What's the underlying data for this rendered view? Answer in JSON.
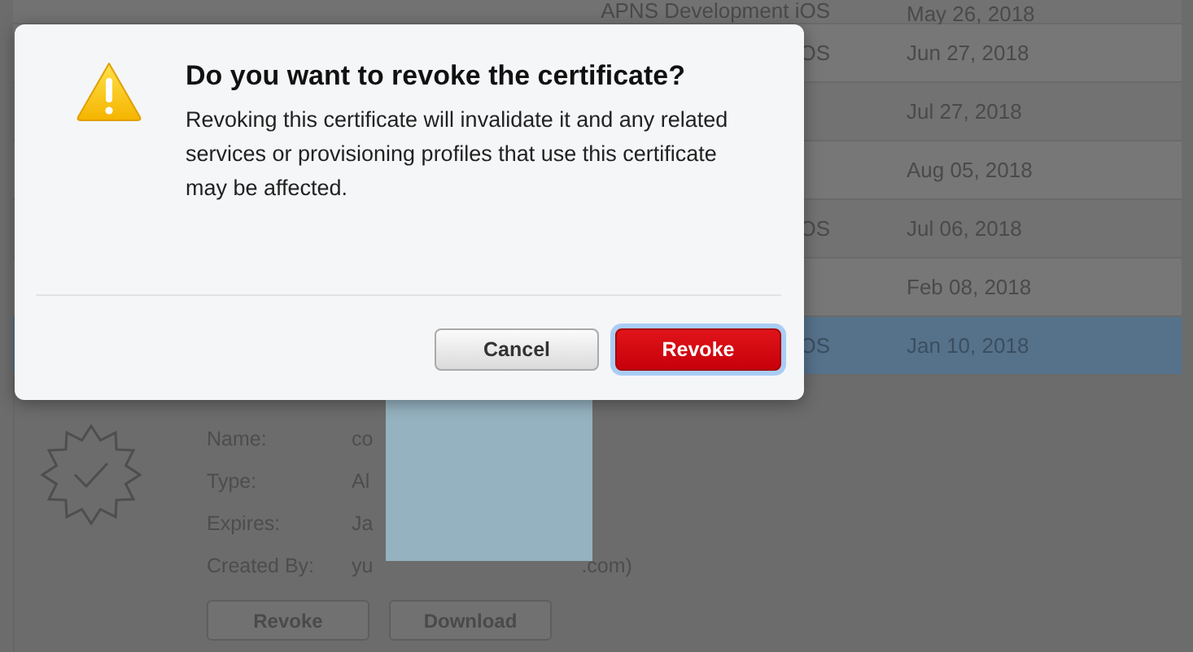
{
  "table": {
    "rows": [
      {
        "name": "",
        "type": "APNS Development iOS",
        "date": "May 26, 2018",
        "selected": false
      },
      {
        "name": "",
        "type": "OS",
        "date": "Jun 27, 2018",
        "selected": false
      },
      {
        "name": "",
        "type": "",
        "date": "Jul 27, 2018",
        "selected": false
      },
      {
        "name": "",
        "type": "",
        "date": "Aug 05, 2018",
        "selected": false
      },
      {
        "name": "",
        "type": "OS",
        "date": "Jul 06, 2018",
        "selected": false
      },
      {
        "name": "",
        "type": "",
        "date": "Feb 08, 2018",
        "selected": false
      },
      {
        "name": "",
        "type": "OS",
        "date": "Jan 10, 2018",
        "selected": true
      }
    ]
  },
  "details": {
    "fields": [
      {
        "label": "Name:",
        "value": "co"
      },
      {
        "label": "Type:",
        "value": "Al"
      },
      {
        "label": "Expires:",
        "value": "Ja"
      },
      {
        "label": "Created By:",
        "value": "yu",
        "value_tail": ".com)"
      }
    ],
    "buttons": [
      "Revoke",
      "Download"
    ]
  },
  "dialog": {
    "title": "Do you want to revoke the certificate?",
    "message": "Revoking this certificate will invalidate it and any related services or provisioning profiles that use this certificate may be affected.",
    "buttons": [
      {
        "label": "Cancel",
        "kind": "secondary"
      },
      {
        "label": "Revoke",
        "kind": "destructive"
      }
    ]
  }
}
